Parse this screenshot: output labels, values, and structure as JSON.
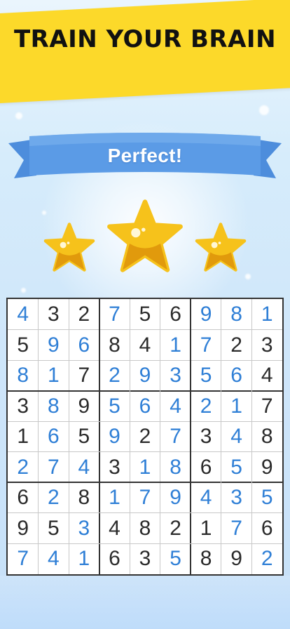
{
  "header": {
    "title": "TRAIN YOUR BRAIN"
  },
  "result": {
    "label": "Perfect!",
    "stars": [
      {
        "icon": "star-icon",
        "size": "small"
      },
      {
        "icon": "star-icon",
        "size": "large"
      },
      {
        "icon": "star-icon",
        "size": "small"
      }
    ]
  },
  "board": {
    "rows": [
      [
        {
          "v": "4",
          "t": "f"
        },
        {
          "v": "3",
          "t": "g"
        },
        {
          "v": "2",
          "t": "g"
        },
        {
          "v": "7",
          "t": "f"
        },
        {
          "v": "5",
          "t": "g"
        },
        {
          "v": "6",
          "t": "g"
        },
        {
          "v": "9",
          "t": "f"
        },
        {
          "v": "8",
          "t": "f"
        },
        {
          "v": "1",
          "t": "f"
        }
      ],
      [
        {
          "v": "5",
          "t": "g"
        },
        {
          "v": "9",
          "t": "f"
        },
        {
          "v": "6",
          "t": "f"
        },
        {
          "v": "8",
          "t": "g"
        },
        {
          "v": "4",
          "t": "g"
        },
        {
          "v": "1",
          "t": "f"
        },
        {
          "v": "7",
          "t": "f"
        },
        {
          "v": "2",
          "t": "g"
        },
        {
          "v": "3",
          "t": "g"
        }
      ],
      [
        {
          "v": "8",
          "t": "f"
        },
        {
          "v": "1",
          "t": "f"
        },
        {
          "v": "7",
          "t": "g"
        },
        {
          "v": "2",
          "t": "f"
        },
        {
          "v": "9",
          "t": "f"
        },
        {
          "v": "3",
          "t": "f"
        },
        {
          "v": "5",
          "t": "f"
        },
        {
          "v": "6",
          "t": "f"
        },
        {
          "v": "4",
          "t": "g"
        }
      ],
      [
        {
          "v": "3",
          "t": "g"
        },
        {
          "v": "8",
          "t": "f"
        },
        {
          "v": "9",
          "t": "g"
        },
        {
          "v": "5",
          "t": "f"
        },
        {
          "v": "6",
          "t": "f"
        },
        {
          "v": "4",
          "t": "f"
        },
        {
          "v": "2",
          "t": "f"
        },
        {
          "v": "1",
          "t": "f"
        },
        {
          "v": "7",
          "t": "g"
        }
      ],
      [
        {
          "v": "1",
          "t": "g"
        },
        {
          "v": "6",
          "t": "f"
        },
        {
          "v": "5",
          "t": "g"
        },
        {
          "v": "9",
          "t": "f"
        },
        {
          "v": "2",
          "t": "g"
        },
        {
          "v": "7",
          "t": "f"
        },
        {
          "v": "3",
          "t": "g"
        },
        {
          "v": "4",
          "t": "f"
        },
        {
          "v": "8",
          "t": "g"
        }
      ],
      [
        {
          "v": "2",
          "t": "f"
        },
        {
          "v": "7",
          "t": "f"
        },
        {
          "v": "4",
          "t": "f"
        },
        {
          "v": "3",
          "t": "g"
        },
        {
          "v": "1",
          "t": "f"
        },
        {
          "v": "8",
          "t": "f"
        },
        {
          "v": "6",
          "t": "g"
        },
        {
          "v": "5",
          "t": "f"
        },
        {
          "v": "9",
          "t": "g"
        }
      ],
      [
        {
          "v": "6",
          "t": "g"
        },
        {
          "v": "2",
          "t": "f"
        },
        {
          "v": "8",
          "t": "g"
        },
        {
          "v": "1",
          "t": "f"
        },
        {
          "v": "7",
          "t": "f"
        },
        {
          "v": "9",
          "t": "f"
        },
        {
          "v": "4",
          "t": "f"
        },
        {
          "v": "3",
          "t": "f"
        },
        {
          "v": "5",
          "t": "f"
        }
      ],
      [
        {
          "v": "9",
          "t": "g"
        },
        {
          "v": "5",
          "t": "g"
        },
        {
          "v": "3",
          "t": "f"
        },
        {
          "v": "4",
          "t": "g"
        },
        {
          "v": "8",
          "t": "g"
        },
        {
          "v": "2",
          "t": "g"
        },
        {
          "v": "1",
          "t": "g"
        },
        {
          "v": "7",
          "t": "f"
        },
        {
          "v": "6",
          "t": "g"
        }
      ],
      [
        {
          "v": "7",
          "t": "f"
        },
        {
          "v": "4",
          "t": "f"
        },
        {
          "v": "1",
          "t": "f"
        },
        {
          "v": "6",
          "t": "g"
        },
        {
          "v": "3",
          "t": "g"
        },
        {
          "v": "5",
          "t": "f"
        },
        {
          "v": "8",
          "t": "g"
        },
        {
          "v": "9",
          "t": "g"
        },
        {
          "v": "2",
          "t": "f"
        }
      ]
    ]
  },
  "colors": {
    "banner": "#fcd92a",
    "ribbon": "#5b9be6",
    "given_digit": "#2b2b2b",
    "filled_digit": "#2f7fd6",
    "star_fill": "#f6c21b",
    "star_shade": "#e19a0c"
  }
}
